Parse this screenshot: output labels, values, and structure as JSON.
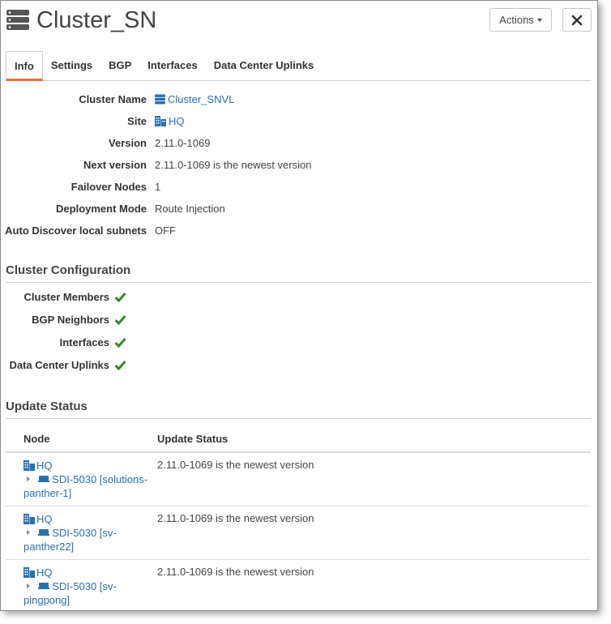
{
  "header": {
    "title": "Cluster_SN",
    "actions_label": "Actions"
  },
  "tabs": [
    {
      "label": "Info"
    },
    {
      "label": "Settings"
    },
    {
      "label": "BGP"
    },
    {
      "label": "Interfaces"
    },
    {
      "label": "Data Center Uplinks"
    }
  ],
  "info": {
    "cluster_name": {
      "label": "Cluster Name",
      "value": "Cluster_SNVL"
    },
    "site": {
      "label": "Site",
      "value": "HQ"
    },
    "version": {
      "label": "Version",
      "value": "2.11.0-1069"
    },
    "next_version": {
      "label": "Next version",
      "value": "2.11.0-1069 is the newest version"
    },
    "failover_nodes": {
      "label": "Failover Nodes",
      "value": "1"
    },
    "deployment_mode": {
      "label": "Deployment Mode",
      "value": "Route Injection"
    },
    "auto_discover": {
      "label": "Auto Discover local subnets",
      "value": "OFF"
    }
  },
  "cluster_config": {
    "title": "Cluster Configuration",
    "items": [
      {
        "label": "Cluster Members",
        "ok": true
      },
      {
        "label": "BGP Neighbors",
        "ok": true
      },
      {
        "label": "Interfaces",
        "ok": true
      },
      {
        "label": "Data Center Uplinks",
        "ok": true
      }
    ]
  },
  "update_status": {
    "title": "Update Status",
    "columns": [
      "Node",
      "Update Status"
    ],
    "rows": [
      {
        "site": "HQ",
        "device_line1": "SDI-5030 [solutions-",
        "device_line2": "panther-1]",
        "status": "2.11.0-1069 is the newest version"
      },
      {
        "site": "HQ",
        "device_line1": "SDI-5030 [sv-",
        "device_line2": "panther22]",
        "status": "2.11.0-1069 is the newest version"
      },
      {
        "site": "HQ",
        "device_line1": "SDI-5030 [sv-",
        "device_line2": "pingpong]",
        "status": "2.11.0-1069 is the newest version"
      }
    ]
  },
  "colors": {
    "link": "#2a6fb0",
    "check": "#2e8b2e",
    "tab_accent": "#e8733a"
  }
}
